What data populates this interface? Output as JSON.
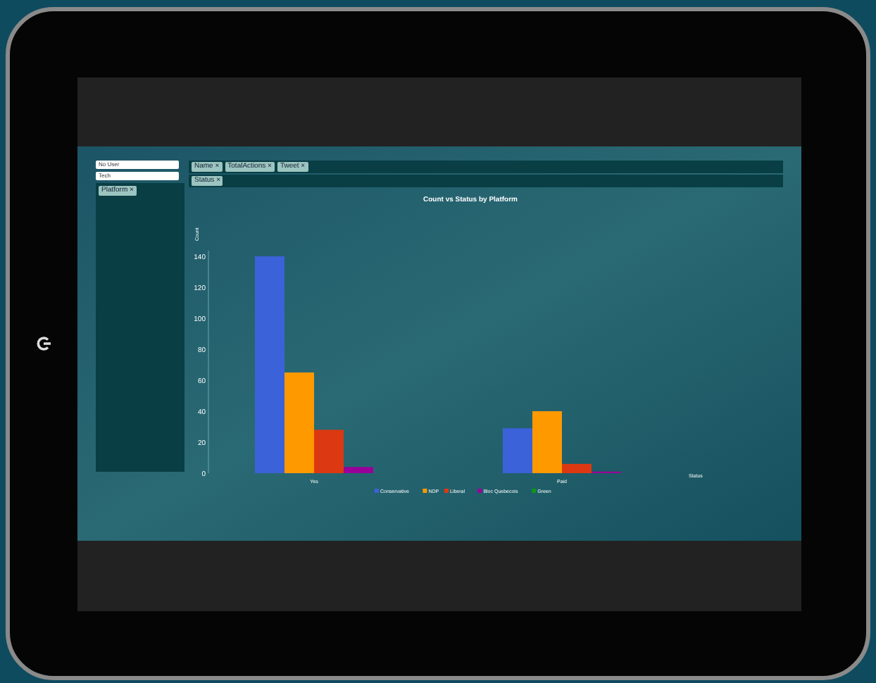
{
  "sidebar": {
    "dropdowns": [
      {
        "value": "No User"
      },
      {
        "value": "Tech"
      }
    ],
    "chips": [
      {
        "label": "Platform ×"
      }
    ]
  },
  "filter_rows": [
    {
      "chips": [
        {
          "label": "Name ×"
        },
        {
          "label": "TotalActions ×"
        },
        {
          "label": "Tweet ×"
        }
      ]
    },
    {
      "chips": [
        {
          "label": "Status ×"
        }
      ]
    }
  ],
  "chart": {
    "chart_data": {
      "type": "bar",
      "title": "Count vs Status by Platform",
      "xlabel": "Status",
      "ylabel": "Count",
      "categories": [
        "Yes",
        "Paid"
      ],
      "series": [
        {
          "name": "Conservative",
          "color": "#3b62d8",
          "values": [
            140,
            29
          ]
        },
        {
          "name": "NDP",
          "color": "#ff9900",
          "values": [
            65,
            40
          ]
        },
        {
          "name": "Liberal",
          "color": "#dc3912",
          "values": [
            28,
            6
          ]
        },
        {
          "name": "Bloc Quebecois",
          "color": "#990099",
          "values": [
            4,
            1
          ]
        },
        {
          "name": "Green",
          "color": "#109618",
          "values": [
            null,
            null
          ]
        }
      ],
      "legend": "bottom",
      "ylim": [
        0,
        140
      ],
      "yticks": [
        0,
        20,
        40,
        60,
        80,
        100,
        120,
        140
      ]
    }
  }
}
